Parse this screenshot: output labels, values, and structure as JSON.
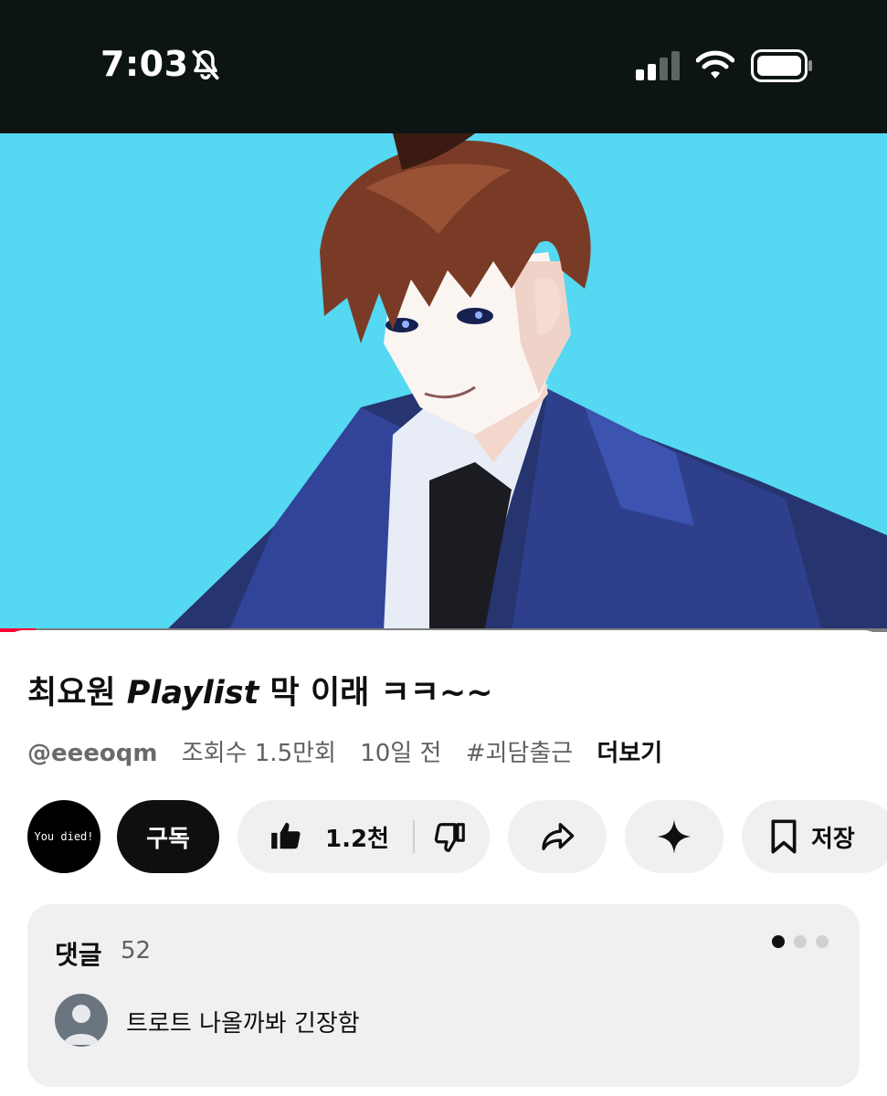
{
  "status_bar": {
    "time": "7:03",
    "icons": [
      "bell-slash-icon",
      "cellular-signal-icon",
      "wifi-icon",
      "battery-icon"
    ]
  },
  "video": {
    "progress_fraction": 0.04,
    "colors": {
      "background": "#55d8f2",
      "progress": "#ff0033"
    }
  },
  "title": {
    "part1": "최요원 ",
    "part2": "Playlist",
    "part3": " 막 이래 ㅋㅋ~~"
  },
  "meta": {
    "channel": "@eeeoqm",
    "views": "조회수 1.5만회",
    "age": "10일 전",
    "hashtag": "#괴담출근",
    "more": "더보기"
  },
  "actions": {
    "avatar_text": "You died!",
    "subscribe": "구독",
    "like_count": "1.2천",
    "save": "저장"
  },
  "comments": {
    "title": "댓글",
    "count": "52",
    "first_comment": "트로트 나올까봐 긴장함"
  }
}
